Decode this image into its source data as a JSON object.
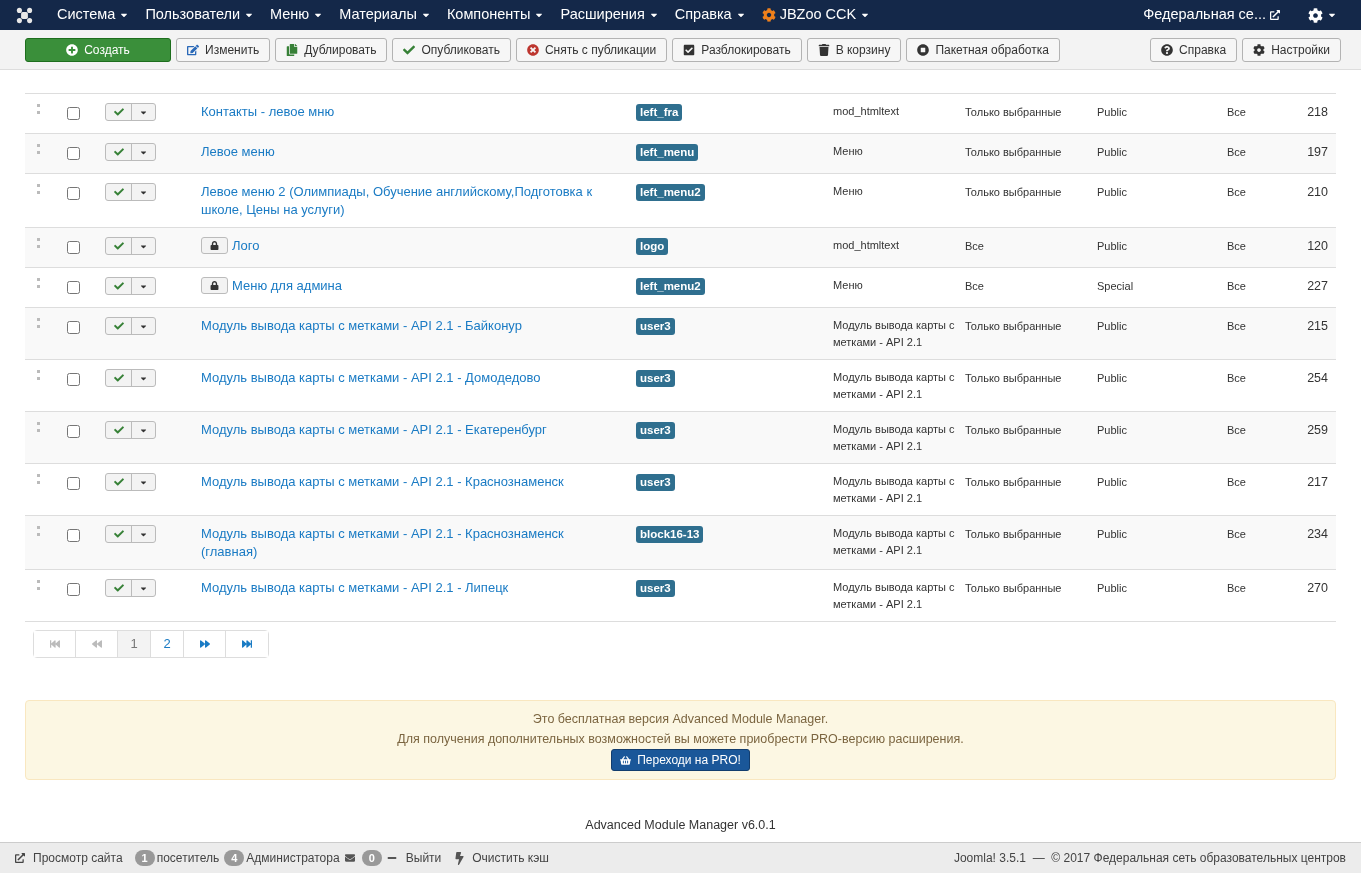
{
  "menu": [
    {
      "label": "Система",
      "kind": "plain"
    },
    {
      "label": "Пользователи",
      "kind": "plain"
    },
    {
      "label": "Меню",
      "kind": "plain"
    },
    {
      "label": "Материалы",
      "kind": "plain"
    },
    {
      "label": "Компоненты",
      "kind": "plain"
    },
    {
      "label": "Расширения",
      "kind": "plain"
    },
    {
      "label": "Справка",
      "kind": "plain"
    },
    {
      "label": "JBZoo CCK",
      "kind": "extension"
    }
  ],
  "site_link": "Федеральная се...",
  "toolbar": [
    {
      "label": "Создать",
      "kind": "create"
    },
    {
      "label": "Изменить",
      "kind": "edit"
    },
    {
      "label": "Дублировать",
      "kind": "copy"
    },
    {
      "label": "Опубликовать",
      "kind": "publish"
    },
    {
      "label": "Снять с публикации",
      "kind": "unpublish"
    },
    {
      "label": "Разблокировать",
      "kind": "checkin"
    },
    {
      "label": "В корзину",
      "kind": "trash"
    },
    {
      "label": "Пакетная обработка",
      "kind": "batch"
    }
  ],
  "toolbar_right": [
    {
      "label": "Справка",
      "kind": "help"
    },
    {
      "label": "Настройки",
      "kind": "options"
    }
  ],
  "rows": [
    {
      "title": "Контакты - левое мню",
      "checked": false,
      "locked": false,
      "published": true,
      "position": "left_fra",
      "type": "mod_htmltext",
      "pages": "Только выбранные",
      "access": "Public",
      "language": "Все",
      "id": "218"
    },
    {
      "title": "Левое меню",
      "checked": false,
      "locked": false,
      "published": true,
      "position": "left_menu",
      "type": "Меню",
      "pages": "Только выбранные",
      "access": "Public",
      "language": "Все",
      "id": "197"
    },
    {
      "title": "Левое меню 2 (Олимпиады, Обучение английскому,Подготовка к школе, Цены на услуги)",
      "checked": false,
      "locked": false,
      "published": true,
      "position": "left_menu2",
      "type": "Меню",
      "pages": "Только выбранные",
      "access": "Public",
      "language": "Все",
      "id": "210"
    },
    {
      "title": "Лого",
      "checked": false,
      "locked": true,
      "published": true,
      "position": "logo",
      "type": "mod_htmltext",
      "pages": "Все",
      "access": "Public",
      "language": "Все",
      "id": "120"
    },
    {
      "title": "Меню для админа",
      "checked": false,
      "locked": true,
      "published": true,
      "position": "left_menu2",
      "type": "Меню",
      "pages": "Все",
      "access": "Special",
      "language": "Все",
      "id": "227"
    },
    {
      "title": "Модуль вывода карты с метками - API 2.1 - Байконур",
      "checked": false,
      "locked": false,
      "published": true,
      "position": "user3",
      "type": "Модуль вывода карты с метками - API 2.1",
      "pages": "Только выбранные",
      "access": "Public",
      "language": "Все",
      "id": "215"
    },
    {
      "title": "Модуль вывода карты с метками - API 2.1 - Домодедово",
      "checked": false,
      "locked": false,
      "published": true,
      "position": "user3",
      "type": "Модуль вывода карты с метками - API 2.1",
      "pages": "Только выбранные",
      "access": "Public",
      "language": "Все",
      "id": "254"
    },
    {
      "title": "Модуль вывода карты с метками - API 2.1 - Екатеренбург",
      "checked": false,
      "locked": false,
      "published": true,
      "position": "user3",
      "type": "Модуль вывода карты с метками - API 2.1",
      "pages": "Только выбранные",
      "access": "Public",
      "language": "Все",
      "id": "259"
    },
    {
      "title": "Модуль вывода карты с метками - API 2.1 - Краснознаменск",
      "checked": false,
      "locked": false,
      "published": true,
      "position": "user3",
      "type": "Модуль вывода карты с метками - API 2.1",
      "pages": "Только выбранные",
      "access": "Public",
      "language": "Все",
      "id": "217"
    },
    {
      "title": "Модуль вывода карты с метками - API 2.1 - Краснознаменск (главная)",
      "checked": false,
      "locked": false,
      "published": true,
      "position": "block16-13",
      "type": "Модуль вывода карты с метками - API 2.1",
      "pages": "Только выбранные",
      "access": "Public",
      "language": "Все",
      "id": "234"
    },
    {
      "title": "Модуль вывода карты с метками - API 2.1 - Липецк",
      "checked": false,
      "locked": false,
      "published": true,
      "position": "user3",
      "type": "Модуль вывода карты с метками - API 2.1",
      "pages": "Только выбранные",
      "access": "Public",
      "language": "Все",
      "id": "270"
    }
  ],
  "pagination": [
    {
      "kind": "first",
      "disabled": true,
      "selected": false
    },
    {
      "kind": "prev",
      "disabled": true,
      "selected": false
    },
    {
      "kind": "page",
      "label": "1",
      "disabled": false,
      "selected": true
    },
    {
      "kind": "page",
      "label": "2",
      "disabled": false,
      "selected": false
    },
    {
      "kind": "next",
      "disabled": false,
      "selected": false
    },
    {
      "kind": "last",
      "disabled": false,
      "selected": false
    }
  ],
  "notice": {
    "lines": [
      "Это бесплатная версия Advanced Module Manager.",
      "Для получения дополнительных возможностей вы можете приобрести PRO-версию расширения."
    ],
    "button": "Переходи на PRO!"
  },
  "version": "Advanced Module Manager v6.0.1",
  "status_bar": {
    "view_site": "Просмотр сайта",
    "visitors_count": "1",
    "visitors": "посетитель",
    "admins_count": "4",
    "admins": "Администратора",
    "messages_count": "0",
    "logout": "Выйти",
    "clear_cache": "Очистить кэш",
    "copyright": "Joomla! 3.5.1  —  © 2017 Федеральная сеть образовательных центров"
  }
}
